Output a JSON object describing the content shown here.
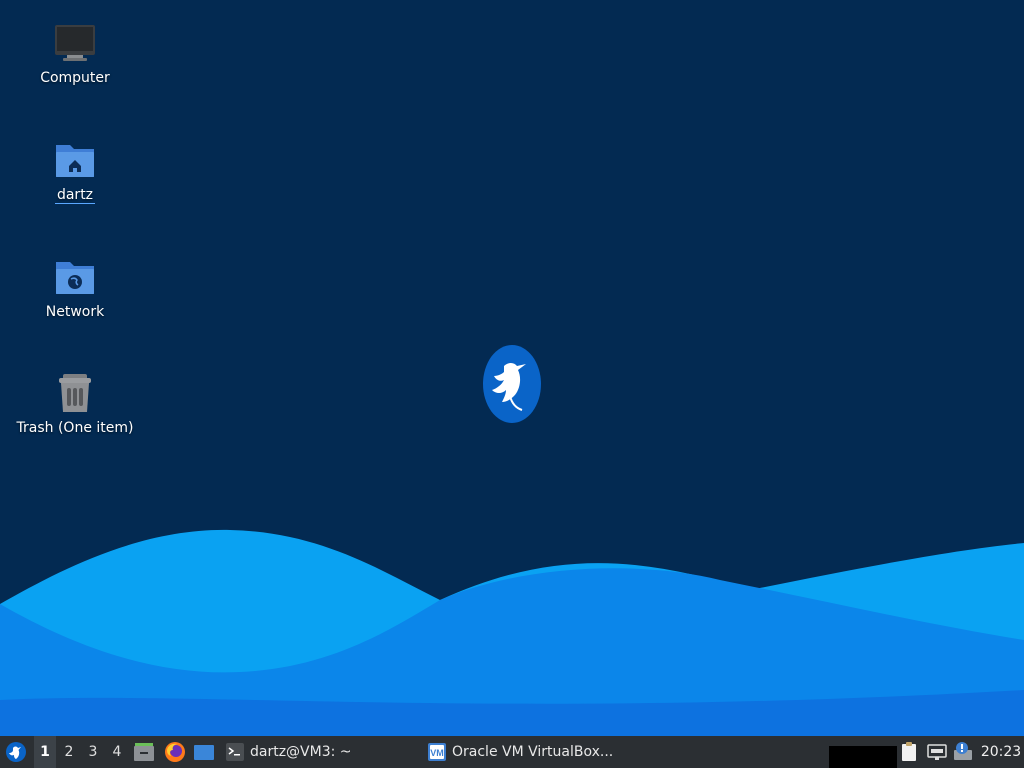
{
  "desktop": {
    "icons": [
      {
        "label": "Computer",
        "icon": "computer-icon"
      },
      {
        "label": "dartz",
        "icon": "home-folder-icon"
      },
      {
        "label": "Network",
        "icon": "network-folder-icon"
      },
      {
        "label": "Trash (One item)",
        "icon": "trash-icon"
      }
    ],
    "logo": "lubuntu-bird-logo"
  },
  "taskbar": {
    "workspaces": [
      "1",
      "2",
      "3",
      "4"
    ],
    "active_workspace": "1",
    "launchers": [
      "file-manager-icon",
      "firefox-icon",
      "show-desktop-icon"
    ],
    "tasks": [
      {
        "label": "dartz@VM3: ~",
        "icon": "terminal-icon"
      },
      {
        "label": "Oracle VM VirtualBox...",
        "icon": "virtualbox-icon"
      }
    ],
    "tray": [
      "clipboard-icon",
      "network-wired-icon",
      "update-notifier-icon"
    ],
    "clock": "20:23"
  },
  "colors": {
    "background": "#032a52",
    "wave_light": "#0aa2f2",
    "wave_mid": "#0b86ea",
    "wave_deep": "#0d72e0",
    "taskbar": "#2b2f33",
    "logo": "#0a64c8"
  }
}
